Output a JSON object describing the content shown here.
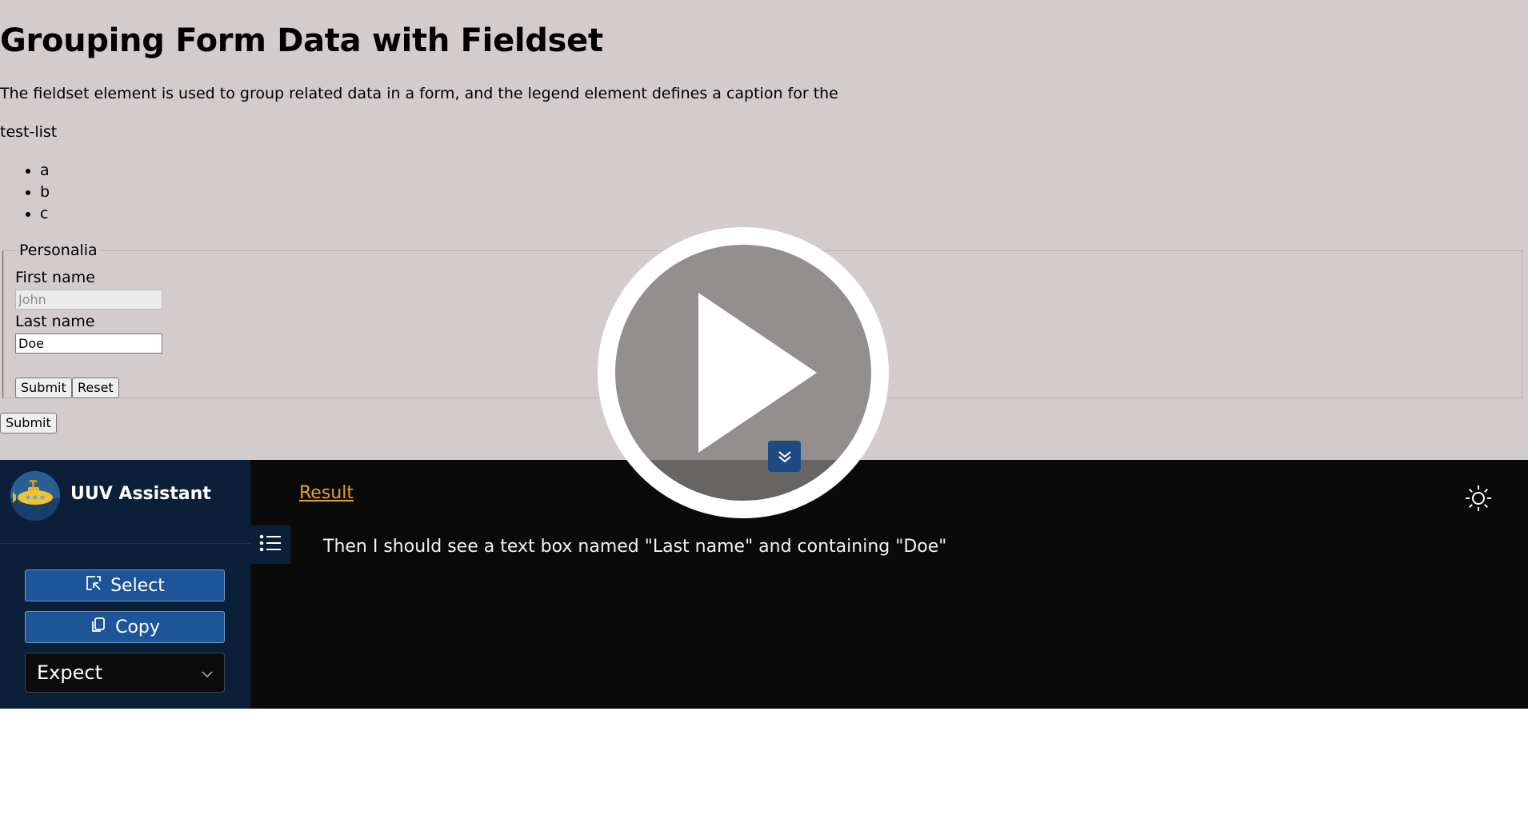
{
  "page": {
    "heading": "Grouping Form Data with Fieldset",
    "description": "The fieldset element is used to group related data in a form, and the legend element defines a caption for the",
    "test_list_label": "test-list",
    "list_items": [
      "a",
      "b",
      "c"
    ],
    "fieldset": {
      "legend": "Personalia",
      "first_name_label": "First name",
      "first_name_value": "John",
      "last_name_label": "Last name",
      "last_name_value": "Doe",
      "submit_label": "Submit",
      "reset_label": "Reset"
    },
    "outer_submit_label": "Submit"
  },
  "assistant": {
    "title": "UUV Assistant",
    "select_label": "Select",
    "copy_label": "Copy",
    "mode_value": "Expect",
    "result_tab": "Result",
    "result_text": "Then I should see a text box named \"Last name\" and containing \"Doe\""
  },
  "colors": {
    "page_bg": "#d3cccd",
    "sidebar_bg": "#0c1f38",
    "button_bg": "#1d5598",
    "result_link": "#e6a22d",
    "panel_bg": "#0a0a0a"
  },
  "icons": [
    "select-icon",
    "copy-icon",
    "chevron-down-icon",
    "list-icon",
    "sun-icon",
    "play-icon",
    "double-chevron-down-icon",
    "submarine-logo"
  ]
}
